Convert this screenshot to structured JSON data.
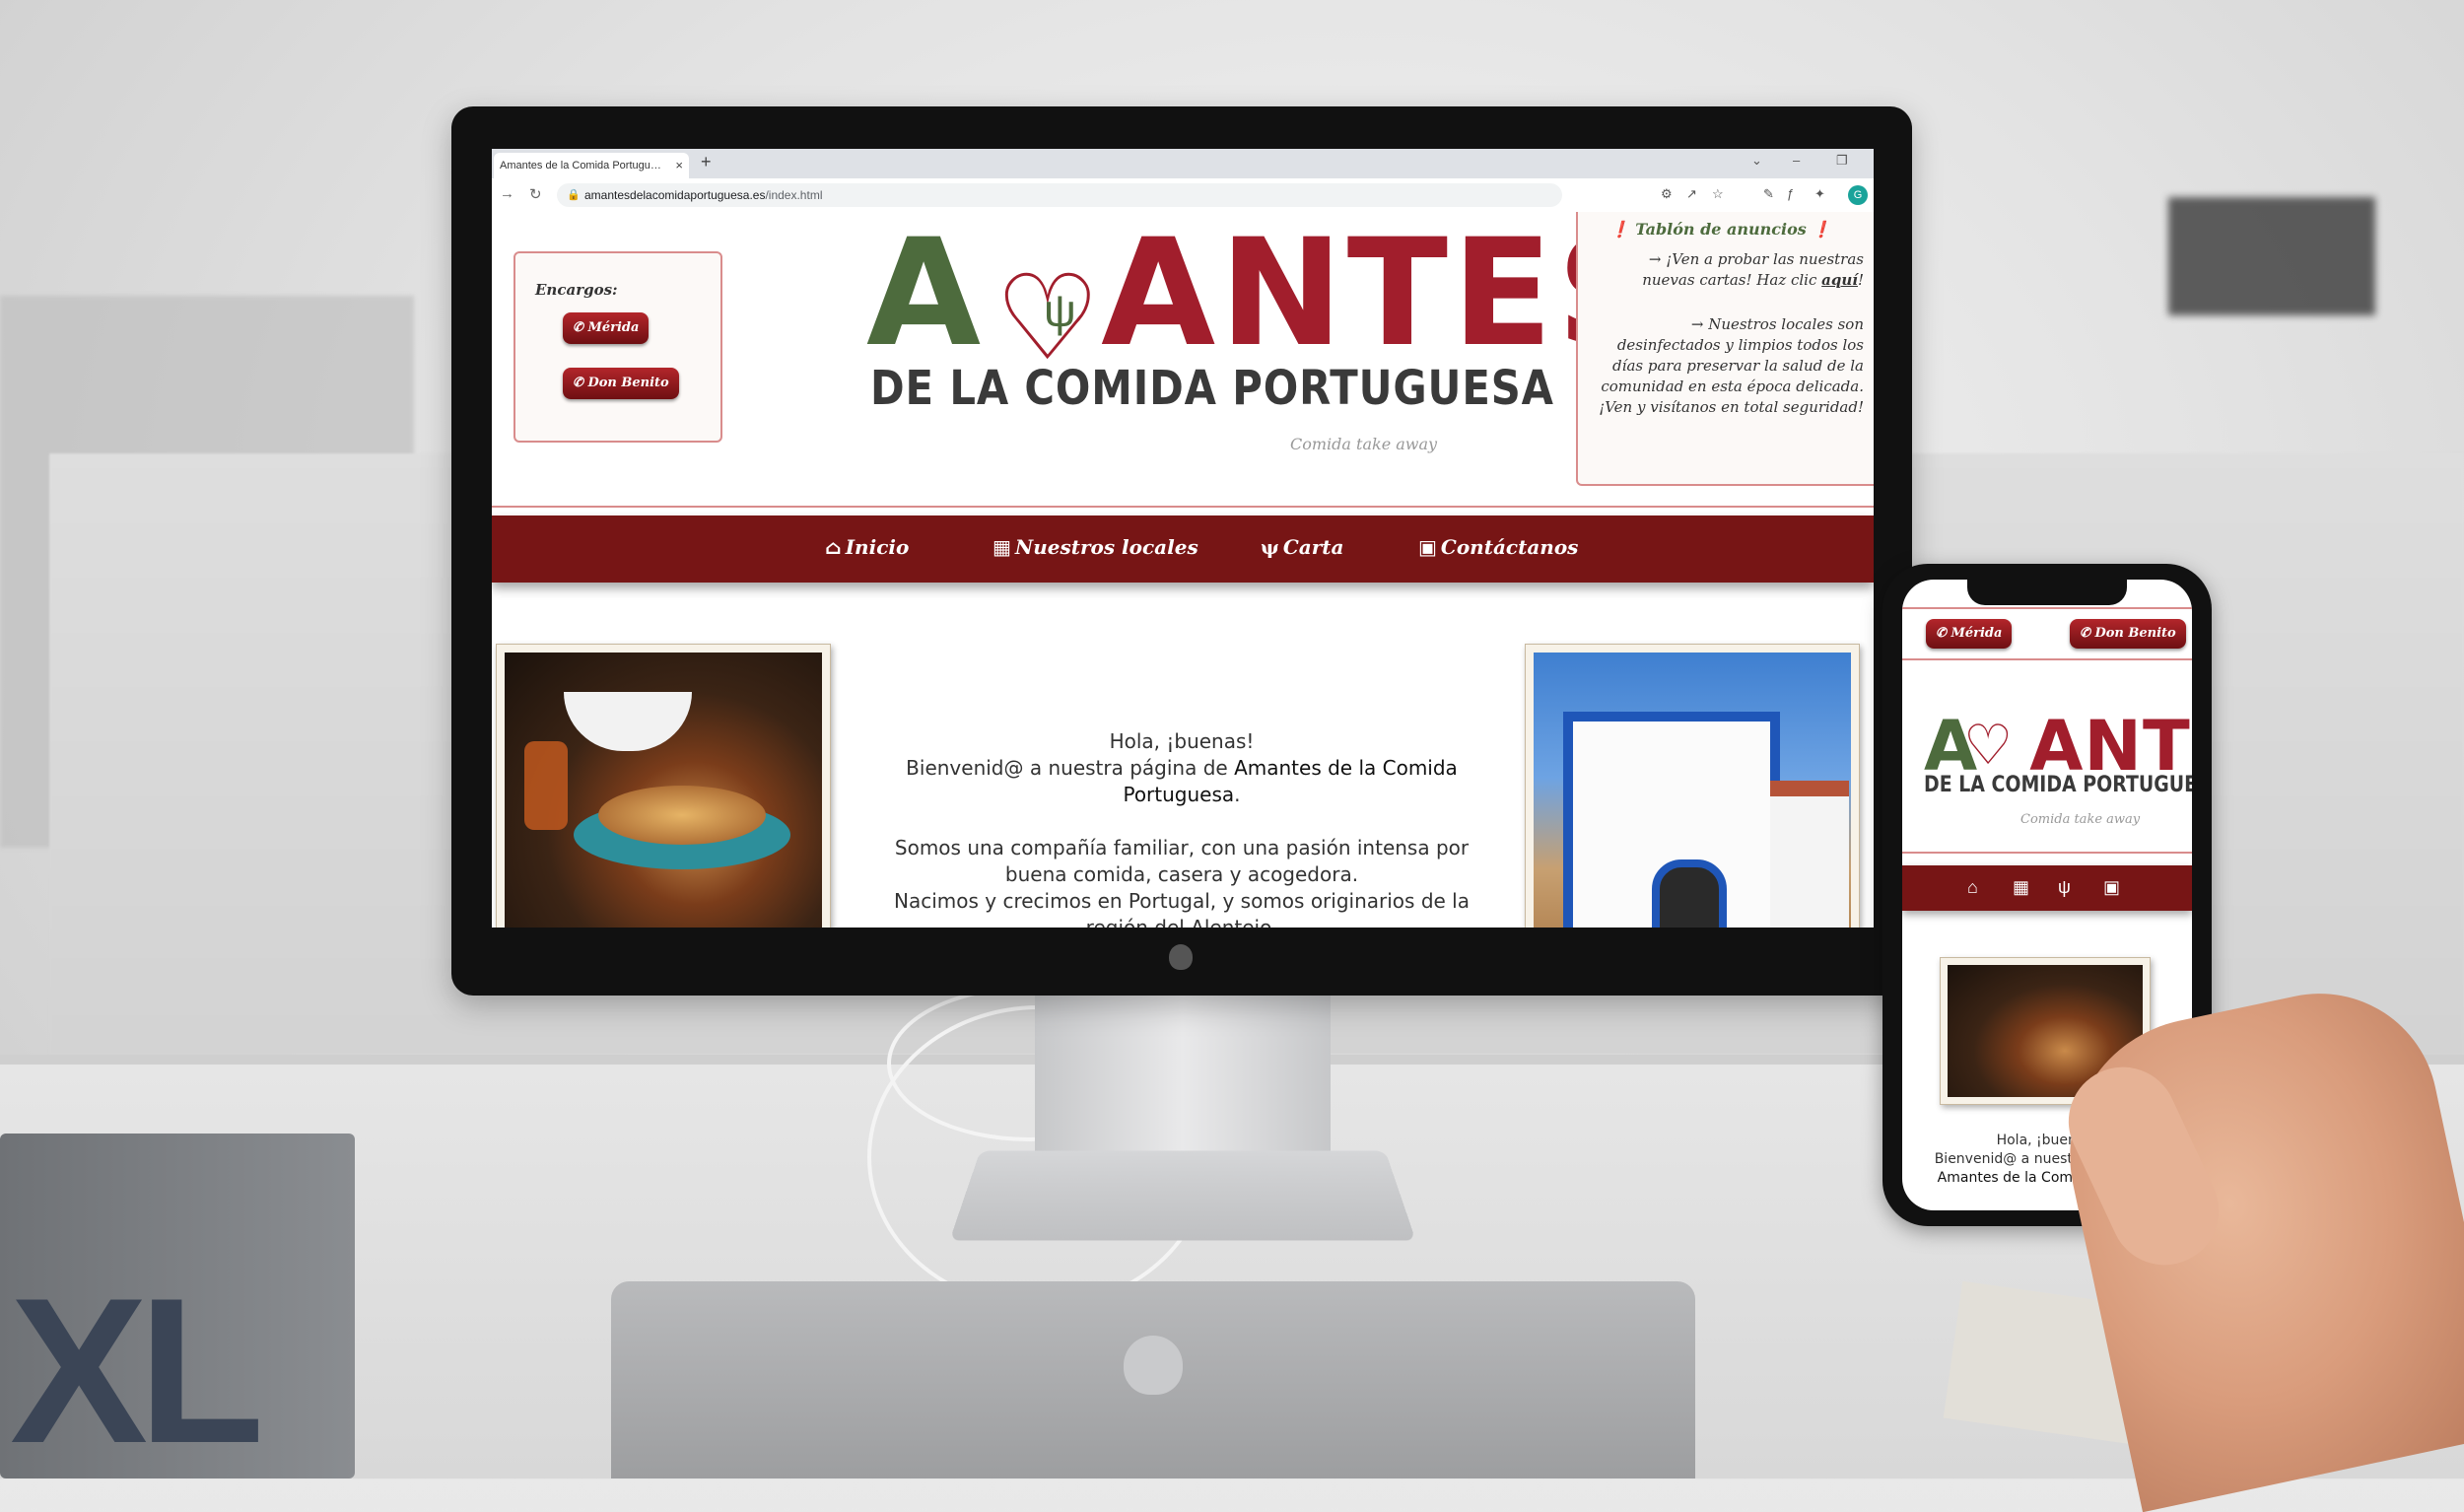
{
  "browser": {
    "tab_title": "Amantes de la Comida Portugu…",
    "tab_close": "×",
    "new_tab": "+",
    "url_domain": "amantesdelacomidaportuguesa.es",
    "url_path": "/index.html"
  },
  "site": {
    "orders": {
      "title": "Encargos:",
      "buttons": [
        "Mérida",
        "Don Benito"
      ]
    },
    "logo": {
      "first_letter": "A",
      "main_rest": "ANTES",
      "subtitle": "DE LA COMIDA PORTUGUESA",
      "tagline": "Comida take away"
    },
    "board": {
      "title": "Tablón de anuncios",
      "notice1_pre": "→ ¡Ven a probar las nuestras nuevas cartas! Haz clic ",
      "notice1_link": "aquí",
      "notice1_post": "!",
      "notice2": "→ Nuestros locales son desinfectados y limpios todos los días para preservar la salud de la comunidad en esta época delicada. ¡Ven y visítanos en total seguridad!"
    },
    "menu": [
      "Inicio",
      "Nuestros locales",
      "Carta",
      "Contáctanos"
    ],
    "welcome": {
      "greeting": "Hola, ¡buenas!",
      "line2_pre": "Bienvenid@ a nuestra página de ",
      "line2_brand": "Amantes de la Comida Portuguesa",
      "line2_post": ".",
      "para2": "Somos una compañía familiar, con una pasión intensa por buena comida, casera y acogedora.",
      "para3": "Nacimos y crecimos en Portugal, y somos originarios de la región del Alentejo."
    }
  },
  "phone": {
    "buttons": [
      "Mérida",
      "Don Benito"
    ],
    "welcome_l1": "Hola, ¡buenas!",
    "welcome_l2": "Bienvenid@ a nuestra página de",
    "welcome_l3": "Amantes de la Comida Portug…"
  },
  "scene": {
    "book_text": "XL"
  },
  "colors": {
    "brand_red": "#771515",
    "logo_green": "#4d6b3d",
    "logo_red": "#a11e2c",
    "border_pink": "#d98c8c"
  }
}
